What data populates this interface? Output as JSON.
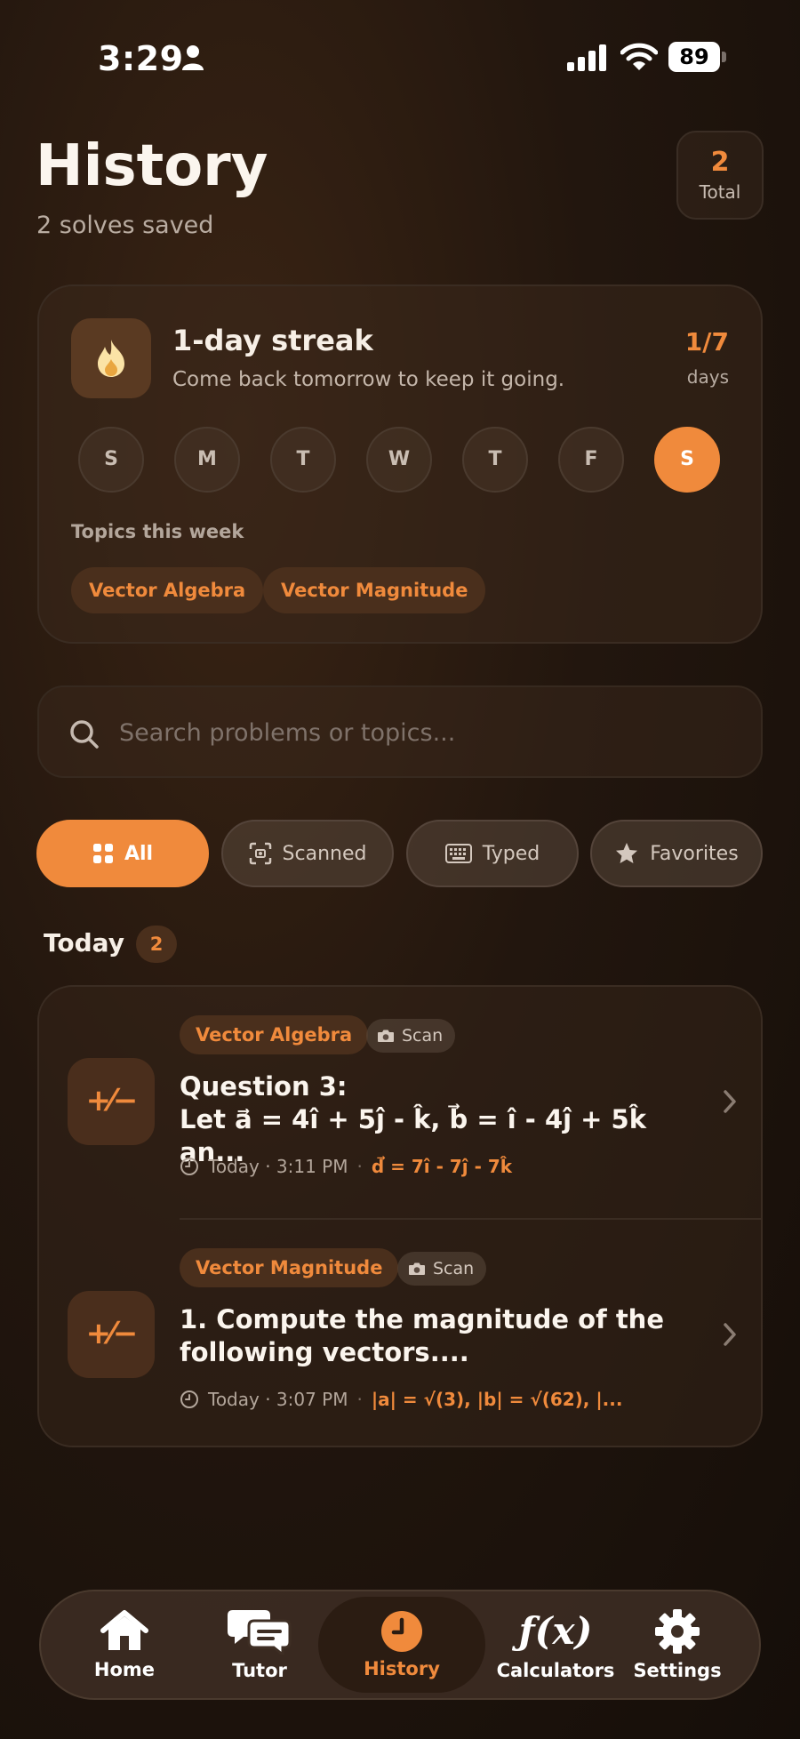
{
  "status_bar": {
    "time": "3:29",
    "battery": "89"
  },
  "header": {
    "title": "History",
    "subtitle": "2 solves saved",
    "total_count": "2",
    "total_label": "Total"
  },
  "streak": {
    "title": "1-day streak",
    "message": "Come back tomorrow to keep it going.",
    "count": "1/7",
    "unit": "days",
    "days": [
      "S",
      "M",
      "T",
      "W",
      "T",
      "F",
      "S"
    ],
    "active_day_index": 6,
    "topics_label": "Topics this week",
    "topics": [
      "Vector Algebra",
      "Vector Magnitude"
    ]
  },
  "search": {
    "placeholder": "Search problems or topics..."
  },
  "filters": [
    {
      "label": "All",
      "icon": "grid-icon",
      "active": true
    },
    {
      "label": "Scanned",
      "icon": "scan-icon",
      "active": false
    },
    {
      "label": "Typed",
      "icon": "keyboard-icon",
      "active": false
    },
    {
      "label": "Favorites",
      "icon": "star-icon",
      "active": false
    }
  ],
  "section": {
    "title": "Today",
    "count": "2"
  },
  "history": [
    {
      "topic": "Vector Algebra",
      "source": "Scan",
      "title": "Question 3:\nLet a⃗ = 4î + 5ĵ - k̂, b⃗ = î - 4ĵ + 5k̂ an...",
      "time": "Today · 3:11 PM",
      "answer": "d⃗ = 7î - 7ĵ - 7k̂"
    },
    {
      "topic": "Vector Magnitude",
      "source": "Scan",
      "title": "1. Compute the magnitude of the\nfollowing vectors....",
      "time": "Today · 3:07 PM",
      "answer": "|a| = √(3), |b| = √(62), |..."
    }
  ],
  "tabbar": [
    {
      "label": "Home",
      "icon": "home-icon"
    },
    {
      "label": "Tutor",
      "icon": "chat-icon"
    },
    {
      "label": "History",
      "icon": "clock-icon",
      "active": true
    },
    {
      "label": "Calculators",
      "icon": "function-icon"
    },
    {
      "label": "Settings",
      "icon": "gear-icon"
    }
  ],
  "colors": {
    "accent": "#f08a3c",
    "background": "#1a110b",
    "card": "#2c1f16"
  }
}
